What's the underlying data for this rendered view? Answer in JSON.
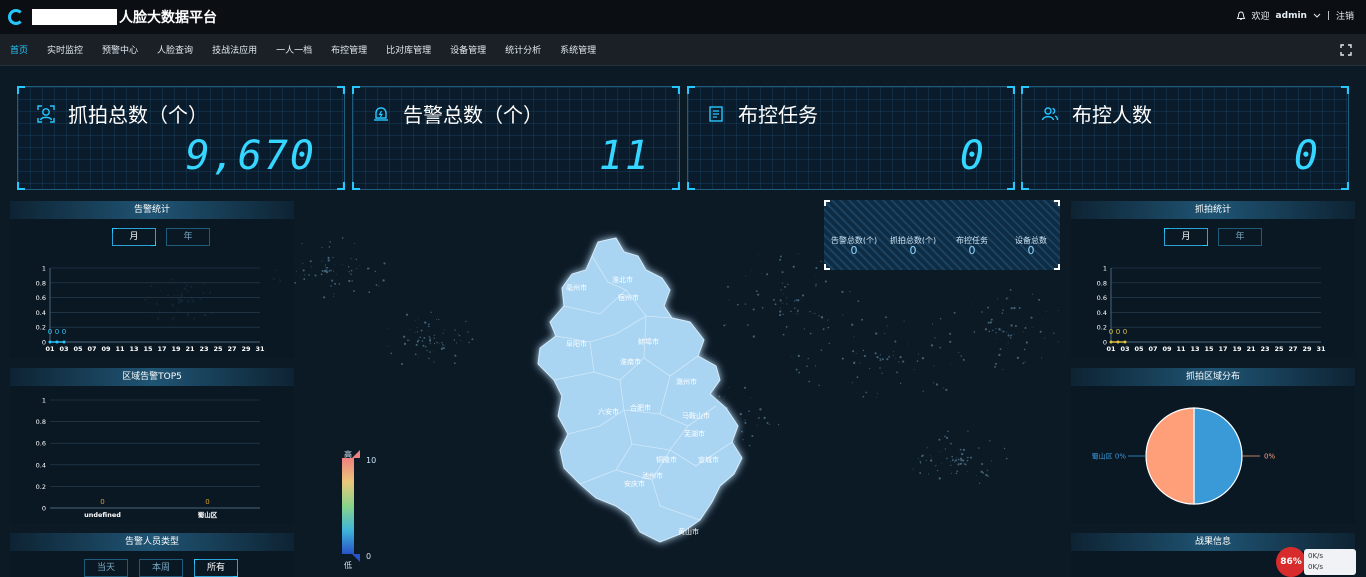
{
  "app": {
    "title": "人脸大数据平台"
  },
  "topbar": {
    "welcome": "欢迎",
    "user": "admin",
    "separator": "|",
    "logout": "注销"
  },
  "nav": {
    "items": [
      "首页",
      "实时监控",
      "预警中心",
      "人脸查询",
      "技战法应用",
      "一人一档",
      "布控管理",
      "比对库管理",
      "设备管理",
      "统计分析",
      "系统管理"
    ]
  },
  "cards": [
    {
      "label": "抓拍总数（个）",
      "value": "9,670",
      "icon": "face-scan-icon"
    },
    {
      "label": "告警总数（个）",
      "value": "11",
      "icon": "alarm-icon"
    },
    {
      "label": "布控任务",
      "value": "0",
      "icon": "task-icon"
    },
    {
      "label": "布控人数",
      "value": "0",
      "icon": "people-icon"
    }
  ],
  "alarm_stats": {
    "title": "告警统计",
    "btn_month": "月",
    "btn_year": "年"
  },
  "capture_stats": {
    "title": "抓拍统计",
    "btn_month": "月",
    "btn_year": "年"
  },
  "region_top5": {
    "title": "区域告警TOP5"
  },
  "alarm_person_type": {
    "title": "告警人员类型",
    "btn_today": "当天",
    "btn_week": "本周",
    "btn_all": "所有"
  },
  "capture_region": {
    "title": "抓拍区域分布"
  },
  "battle_info": {
    "title": "战果信息"
  },
  "mini_stats": [
    {
      "label": "告警总数(个)",
      "value": "0"
    },
    {
      "label": "抓拍总数(个)",
      "value": "0"
    },
    {
      "label": "布控任务",
      "value": "0"
    },
    {
      "label": "设备总数",
      "value": "0"
    }
  ],
  "map": {
    "cities": [
      "淮北市",
      "亳州市",
      "宿州市",
      "阜阳市",
      "蚌埠市",
      "淮南市",
      "滁州市",
      "六安市",
      "合肥市",
      "马鞍山市",
      "芜湖市",
      "铜陵市",
      "宣城市",
      "池州市",
      "安庆市",
      "黄山市"
    ],
    "legend_high": "高",
    "legend_low": "低",
    "legend_max": "10",
    "legend_min": "0",
    "colors": {
      "province": "#a9d4f2",
      "border": "#ffffff"
    }
  },
  "taskbar": {
    "badge": "86%",
    "up": "0K/s",
    "down": "0K/s"
  },
  "chart_data": [
    {
      "type": "line",
      "title": "告警统计",
      "x": [
        "01",
        "03",
        "05",
        "07",
        "09",
        "11",
        "13",
        "15",
        "17",
        "19",
        "21",
        "23",
        "25",
        "27",
        "29",
        "31"
      ],
      "ylim": [
        0,
        1
      ],
      "yticks": [
        "0",
        "0.2",
        "0.4",
        "0.6",
        "0.8",
        "1"
      ],
      "series": [
        {
          "values": [
            0,
            0,
            0
          ],
          "color": "#27c7ff"
        }
      ],
      "data_labels": [
        "0",
        "0",
        "0"
      ]
    },
    {
      "type": "bar",
      "title": "区域告警TOP5",
      "categories": [
        "undefined",
        "蜀山区"
      ],
      "values": [
        0,
        0
      ],
      "ylim": [
        0,
        1
      ],
      "yticks": [
        "0",
        "0.2",
        "0.4",
        "0.6",
        "0.8",
        "1"
      ]
    },
    {
      "type": "line",
      "title": "抓拍统计",
      "x": [
        "01",
        "03",
        "05",
        "07",
        "09",
        "11",
        "13",
        "15",
        "17",
        "19",
        "21",
        "23",
        "25",
        "27",
        "29",
        "31"
      ],
      "ylim": [
        0,
        1
      ],
      "yticks": [
        "0",
        "0.2",
        "0.4",
        "0.6",
        "0.8",
        "1"
      ],
      "series": [
        {
          "values": [
            0,
            0,
            0
          ],
          "color": "#e0c240"
        }
      ],
      "data_labels": [
        "0",
        "0",
        "0"
      ]
    },
    {
      "type": "pie",
      "title": "抓拍区域分布",
      "slices": [
        {
          "label": "蜀山区 0%",
          "value": 50,
          "color": "#3a9ad8"
        },
        {
          "label": "0%",
          "value": 50,
          "color": "#ff9f7a"
        }
      ]
    }
  ]
}
